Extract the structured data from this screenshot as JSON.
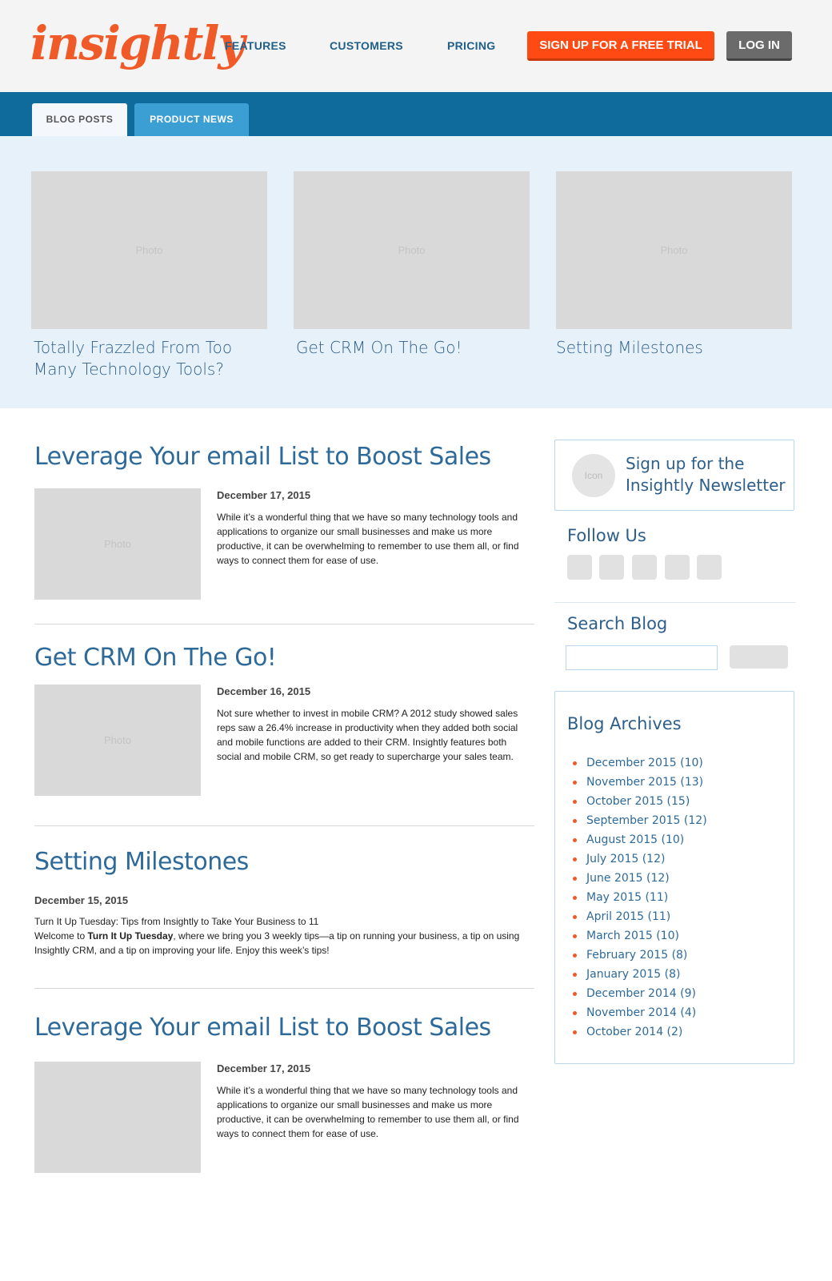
{
  "brand": {
    "logo_text": "insightly",
    "accent": "#f05a28",
    "primary": "#0e6b9c"
  },
  "nav": {
    "features": "FEATURES",
    "customers": "CUSTOMERS",
    "pricing": "PRICING",
    "signup": "SIGN UP FOR A FREE TRIAL",
    "login": "LOG IN"
  },
  "tabs": {
    "blog_posts": "BLOG POSTS",
    "product_news": "PRODUCT NEWS"
  },
  "featured": [
    {
      "photo": "Photo",
      "title": "Totally Frazzled From Too Many Technology Tools?"
    },
    {
      "photo": "Photo",
      "title": "Get CRM On The Go!"
    },
    {
      "photo": "Photo",
      "title": "Setting Milestones"
    }
  ],
  "posts": [
    {
      "title": "Leverage Your email List to Boost Sales",
      "photo": "Photo",
      "date": "December 17, 2015",
      "excerpt": "While it’s a wonderful thing that we have so many technology tools and applications to organize our small businesses and make us more productive, it can be overwhelming to remember to use them all, or find ways to connect them for ease of use."
    },
    {
      "title": "Get CRM On The Go!",
      "photo": "Photo",
      "date": "December 16, 2015",
      "excerpt": "Not sure whether to invest in mobile CRM? A 2012 study showed sales reps saw a 26.4% increase in productivity when they added both social and mobile functions are added to their CRM. Insightly features both social and mobile CRM, so get ready to supercharge your sales team."
    },
    {
      "title": "Setting Milestones",
      "date": "December 15, 2015",
      "line1": "Turn It Up Tuesday: Tips from Insightly to Take Your Business to 11",
      "line2_pre": "Welcome to ",
      "line2_bold": "Turn It Up Tuesday",
      "line2_post": ", where we bring you 3 weekly tips—a tip on running your business, a tip on using Insightly CRM, and a tip on improving your life. Enjoy this week’s tips!"
    },
    {
      "title": "Leverage Your email List to Boost Sales",
      "date": "December 17, 2015",
      "excerpt": "While it’s a wonderful thing that we have so many technology tools and applications to organize our small businesses and make us more productive, it can be overwhelming to remember to use them all, or find ways to connect them for ease of use."
    }
  ],
  "sidebar": {
    "newsletter_icon": "Icon",
    "newsletter": "Sign up for the Insightly Newsletter",
    "follow": "Follow Us",
    "search": "Search Blog",
    "archives_title": "Blog Archives",
    "archives": [
      "December 2015 (10)",
      "November 2015 (13)",
      "October 2015 (15)",
      "September 2015 (12)",
      "August 2015 (10)",
      "July 2015 (12)",
      "June 2015 (12)",
      "May 2015 (11)",
      "April 2015 (11)",
      "March 2015 (10)",
      "February 2015 (8)",
      "January 2015 (8)",
      "December 2014 (9)",
      "November 2014 (4)",
      "October 2014 (2)"
    ]
  }
}
